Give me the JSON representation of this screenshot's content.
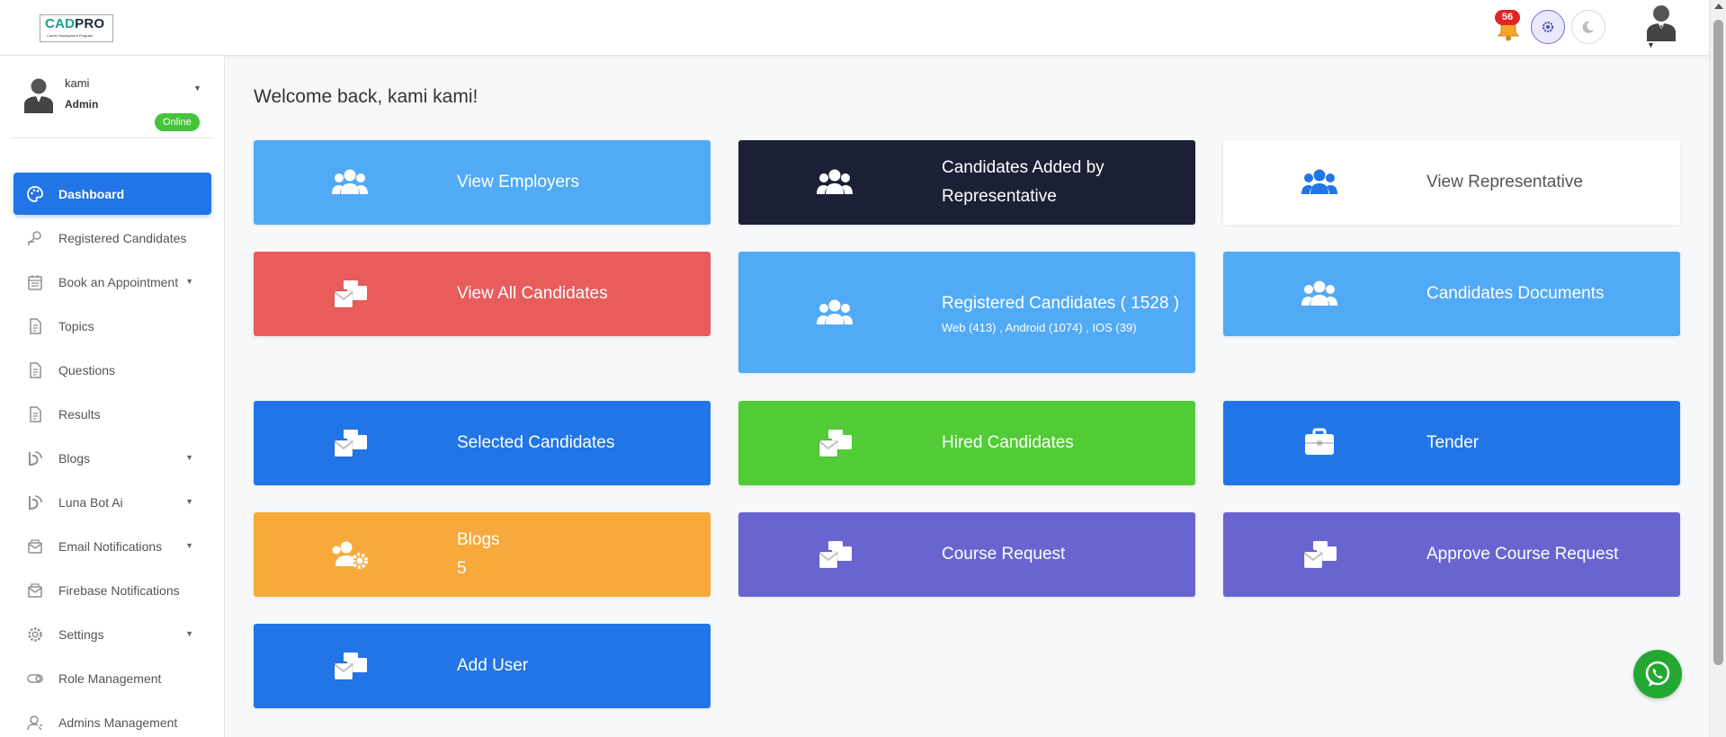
{
  "logo": {
    "brand_left": "CAD",
    "brand_right": "PRO",
    "tagline": "Career Deployment Program"
  },
  "header": {
    "notification_count": "56"
  },
  "user": {
    "name": "kami",
    "role": "Admin",
    "status": "Online"
  },
  "sidebar": {
    "items": [
      {
        "label": "Dashboard",
        "icon": "palette-icon",
        "active": true,
        "caret": false
      },
      {
        "label": "Registered Candidates",
        "icon": "person-search-icon",
        "caret": false
      },
      {
        "label": "Book an Appointment",
        "icon": "calendar-icon",
        "caret": true
      },
      {
        "label": "Topics",
        "icon": "document-icon",
        "caret": false
      },
      {
        "label": "Questions",
        "icon": "document-icon",
        "caret": false
      },
      {
        "label": "Results",
        "icon": "document-icon",
        "caret": false
      },
      {
        "label": "Blogs",
        "icon": "blog-icon",
        "caret": true
      },
      {
        "label": "Luna Bot Ai",
        "icon": "blog-icon",
        "caret": true
      },
      {
        "label": "Email Notifications",
        "icon": "mail-icon",
        "caret": true
      },
      {
        "label": "Firebase Notifications",
        "icon": "mail-icon",
        "caret": false
      },
      {
        "label": "Settings",
        "icon": "gear-icon",
        "caret": true
      },
      {
        "label": "Role Management",
        "icon": "toggle-icon",
        "caret": false
      },
      {
        "label": "Admins Management",
        "icon": "user-icon",
        "caret": false
      }
    ]
  },
  "main": {
    "welcome": "Welcome back, kami kami!",
    "cards": [
      {
        "label": "View Employers",
        "icon": "users-icon",
        "color": "#51aaf5"
      },
      {
        "label": "Candidates Added by Representative",
        "icon": "users-icon",
        "color": "#1b2035"
      },
      {
        "label": "View Representative",
        "icon": "users-icon",
        "color": "#ffffff"
      },
      {
        "label": "View All Candidates",
        "icon": "mail-bulk-icon",
        "color": "#e95c5c"
      },
      {
        "label": "Registered Candidates ( 1528 )",
        "sub": "Web (413) , Android (1074) , IOS (39)",
        "icon": "users-icon",
        "color": "#51aaf5"
      },
      {
        "label": "Candidates Documents",
        "icon": "users-icon",
        "color": "#51aaf5"
      },
      {
        "label": "Selected Candidates",
        "icon": "mail-bulk-icon",
        "color": "#2275e6"
      },
      {
        "label": "Hired Candidates",
        "icon": "mail-bulk-icon",
        "color": "#52cc36"
      },
      {
        "label": "Tender",
        "icon": "briefcase-icon",
        "color": "#2275e6"
      },
      {
        "label": "Blogs",
        "sub": "5",
        "icon": "users-cog-icon",
        "color": "#f7aa3b"
      },
      {
        "label": "Course Request",
        "icon": "mail-bulk-icon",
        "color": "#6a64d1"
      },
      {
        "label": "Approve Course Request",
        "icon": "mail-bulk-icon",
        "color": "#6a64d1"
      },
      {
        "label": "Add User",
        "icon": "mail-bulk-icon",
        "color": "#2275e6"
      }
    ]
  }
}
